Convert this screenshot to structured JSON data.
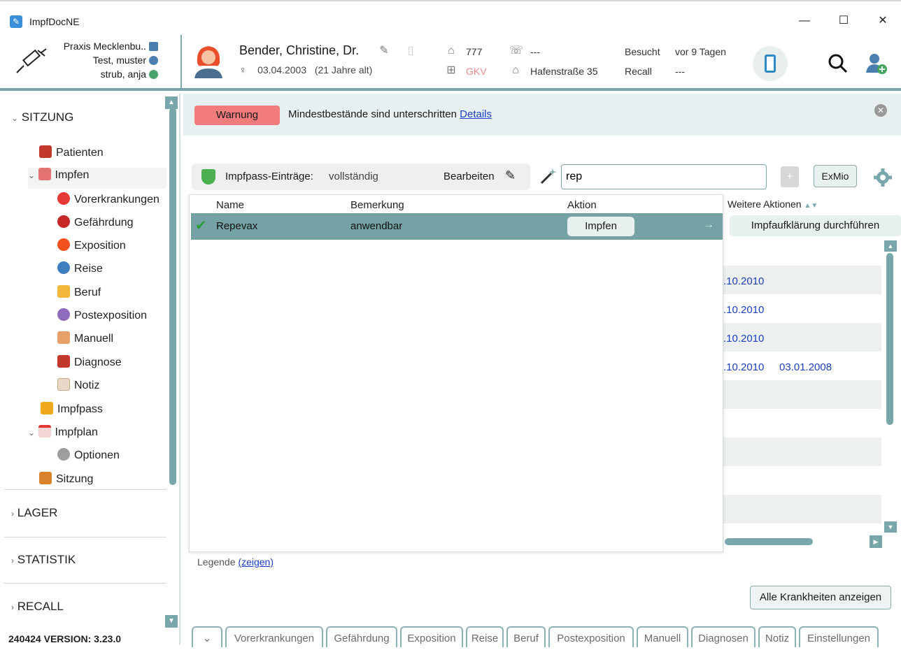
{
  "window": {
    "title": "ImpfDocNE",
    "minimize": "—",
    "maximize": "☐",
    "close": "✕"
  },
  "header": {
    "practice": "Praxis Mecklenbu..",
    "user1": "Test, muster",
    "user2": "strub, anja",
    "patient_name": "Bender, Christine, Dr.",
    "gender_symbol": "♀",
    "birthdate": "03.04.2003",
    "age": "(21 Jahre alt)",
    "tag_value": "777",
    "insurance": "GKV",
    "phone": "---",
    "address": "Hafenstraße 35",
    "visited_label": "Besucht",
    "visited_value": "vor 9 Tagen",
    "recall_label": "Recall",
    "recall_value": "---"
  },
  "sidebar": {
    "sections": {
      "sitzung": "SITZUNG",
      "lager": "LAGER",
      "statistik": "STATISTIK",
      "recall": "RECALL"
    },
    "items": [
      {
        "label": "Patienten"
      },
      {
        "label": "Impfen"
      },
      {
        "label": "Vorerkrankungen"
      },
      {
        "label": "Gefährdung"
      },
      {
        "label": "Exposition"
      },
      {
        "label": "Reise"
      },
      {
        "label": "Beruf"
      },
      {
        "label": "Postexposition"
      },
      {
        "label": "Manuell"
      },
      {
        "label": "Diagnose"
      },
      {
        "label": "Notiz"
      },
      {
        "label": "Impfpass"
      },
      {
        "label": "Impfplan"
      },
      {
        "label": "Optionen"
      },
      {
        "label": "Sitzung"
      }
    ],
    "version": "240424 VERSION: 3.23.0"
  },
  "warning": {
    "badge": "Warnung",
    "text": "Mindestbestände sind unterschritten",
    "link": "Details"
  },
  "impfpass": {
    "label": "Impfpass-Einträge:",
    "status": "vollständig",
    "edit": "Bearbeiten"
  },
  "search": {
    "value": "rep"
  },
  "toolbar": {
    "exmio": "ExMio"
  },
  "dropdown": {
    "headers": {
      "name": "Name",
      "bemerkung": "Bemerkung",
      "aktion": "Aktion"
    },
    "row": {
      "name": "Repevax",
      "bemerkung": "anwendbar",
      "action": "Impfen"
    }
  },
  "table": {
    "weitere_header": "Weitere Aktionen",
    "auf_button": "Impfaufklärung durchführen",
    "dates": [
      ".10.2010",
      ".10.2010",
      ".10.2010",
      ".10.2010"
    ],
    "date_extra": "03.01.2008"
  },
  "legend": {
    "label": "Legende",
    "link": "(zeigen)"
  },
  "all_button": "Alle Krankheiten anzeigen",
  "tabs": [
    "Vorerkrankungen",
    "Gefährdung",
    "Exposition",
    "Reise",
    "Beruf",
    "Postexposition",
    "Manuell",
    "Diagnosen",
    "Notiz",
    "Einstellungen"
  ],
  "colors": {
    "accent": "#7aa7ab",
    "warning": "#f27b7b",
    "link": "#1a3fc9",
    "row_selected": "#75a3a5"
  }
}
